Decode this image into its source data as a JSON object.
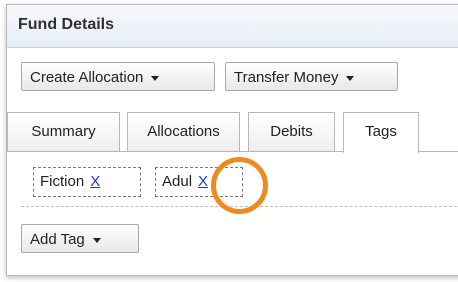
{
  "panel": {
    "title": "Fund Details"
  },
  "toolbar": {
    "create_allocation_label": "Create Allocation",
    "transfer_money_label": "Transfer Money"
  },
  "tabs": [
    {
      "label": "Summary",
      "active": false
    },
    {
      "label": "Allocations",
      "active": false
    },
    {
      "label": "Debits",
      "active": false
    },
    {
      "label": "Tags",
      "active": true
    }
  ],
  "tags": [
    {
      "label": "Fiction",
      "remove_label": "X"
    },
    {
      "label": "Adul",
      "remove_label": "X"
    }
  ],
  "add_tag": {
    "label": "Add Tag"
  },
  "colors": {
    "highlight": "#ef8a1f",
    "link": "#1a3ccf"
  },
  "icons": {
    "dropdown": "caret-down-icon"
  }
}
